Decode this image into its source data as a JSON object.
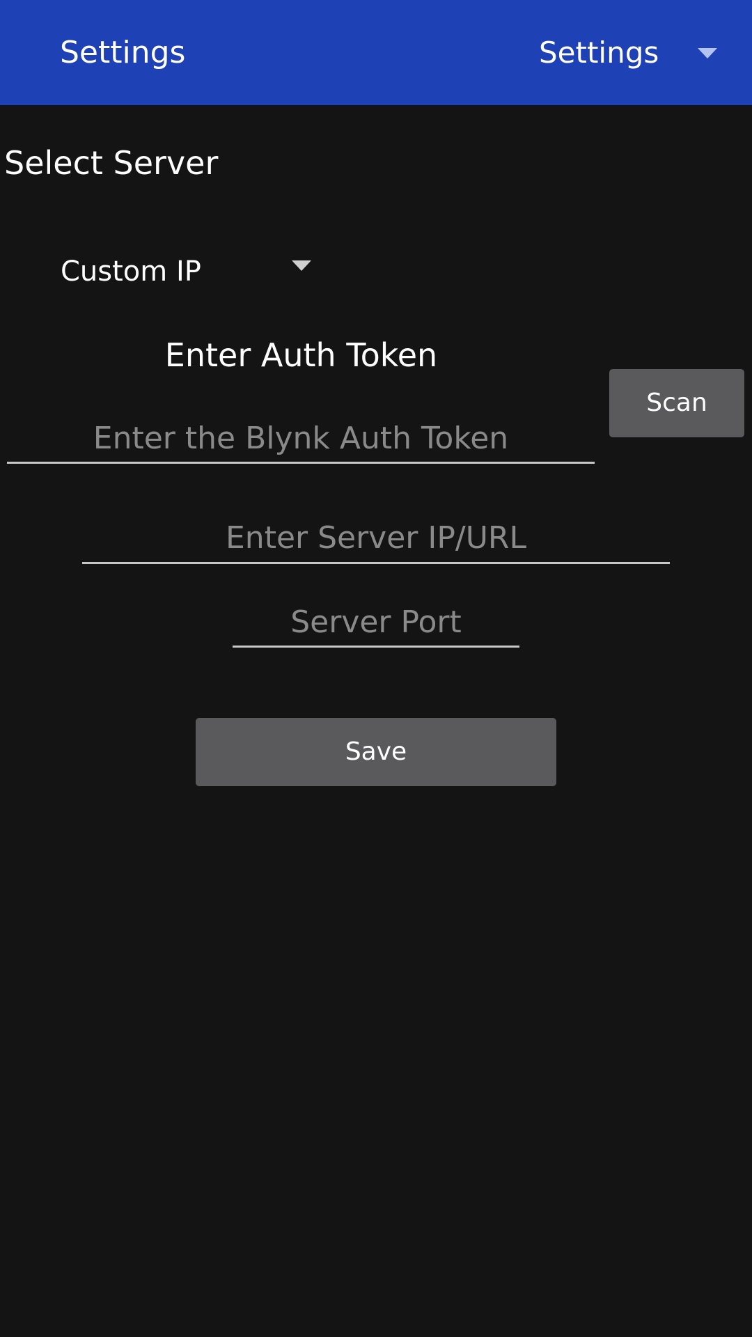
{
  "appbar": {
    "title": "Settings",
    "spinner_value": "Settings",
    "background": "#1f41b6"
  },
  "server": {
    "label": "Select Server",
    "selected": "Custom IP"
  },
  "auth": {
    "heading": "Enter Auth Token",
    "token_placeholder": "Enter the Blynk Auth Token",
    "token_value": "",
    "scan_label": "Scan"
  },
  "connection": {
    "ip_placeholder": "Enter Server IP/URL",
    "ip_value": "",
    "port_placeholder": "Server Port",
    "port_value": ""
  },
  "actions": {
    "save_label": "Save"
  },
  "theme": {
    "background": "#141414",
    "button": "#5a5a5c",
    "placeholder": "#8a8a8a",
    "underline": "#c8c8c8"
  }
}
